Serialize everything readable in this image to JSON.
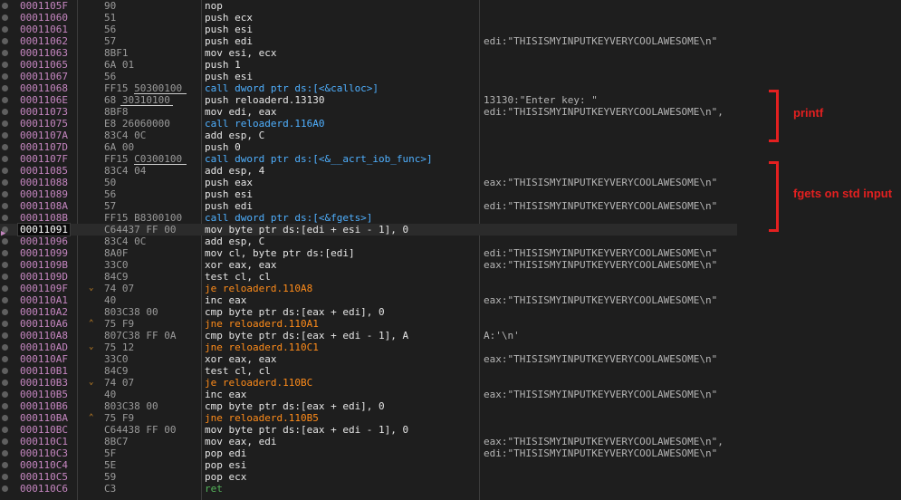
{
  "rows": [
    {
      "addr": "0001105F",
      "bytes": "90",
      "instr": "nop",
      "comment": ""
    },
    {
      "addr": "00011060",
      "bytes": "51",
      "instr": "push ecx",
      "comment": ""
    },
    {
      "addr": "00011061",
      "bytes": "56",
      "instr": "push esi",
      "comment": ""
    },
    {
      "addr": "00011062",
      "bytes": "57",
      "instr": "push edi",
      "comment": "edi:\"THISISMYINPUTKEYVERYCOOLAWESOME\\n\""
    },
    {
      "addr": "00011063",
      "bytes": "8BF1",
      "instr": "mov esi, ecx",
      "comment": ""
    },
    {
      "addr": "00011065",
      "bytes": "6A 01",
      "instr": "push 1",
      "comment": ""
    },
    {
      "addr": "00011067",
      "bytes": "56",
      "instr": "push esi",
      "comment": ""
    },
    {
      "addr": "00011068",
      "bytes": "FF15 50300100",
      "instr": "call dword ptr ds:[<&calloc>]",
      "comment": ""
    },
    {
      "addr": "0001106E",
      "bytes": "68 30310100",
      "instr": "push reloaderd.13130",
      "comment": "13130:\"Enter key: \""
    },
    {
      "addr": "00011073",
      "bytes": "8BF8",
      "instr": "mov edi, eax",
      "comment": "edi:\"THISISMYINPUTKEYVERYCOOLAWESOME\\n\","
    },
    {
      "addr": "00011075",
      "bytes": "E8 26060000",
      "instr": "call reloaderd.116A0",
      "comment": ""
    },
    {
      "addr": "0001107A",
      "bytes": "83C4 0C",
      "instr": "add esp, C",
      "comment": ""
    },
    {
      "addr": "0001107D",
      "bytes": "6A 00",
      "instr": "push 0",
      "comment": ""
    },
    {
      "addr": "0001107F",
      "bytes": "FF15 C0300100",
      "instr": "call dword ptr ds:[<&__acrt_iob_func>]",
      "comment": ""
    },
    {
      "addr": "00011085",
      "bytes": "83C4 04",
      "instr": "add esp, 4",
      "comment": ""
    },
    {
      "addr": "00011088",
      "bytes": "50",
      "instr": "push eax",
      "comment": "eax:\"THISISMYINPUTKEYVERYCOOLAWESOME\\n\""
    },
    {
      "addr": "00011089",
      "bytes": "56",
      "instr": "push esi",
      "comment": ""
    },
    {
      "addr": "0001108A",
      "bytes": "57",
      "instr": "push edi",
      "comment": "edi:\"THISISMYINPUTKEYVERYCOOLAWESOME\\n\""
    },
    {
      "addr": "0001108B",
      "bytes": "FF15 B8300100",
      "instr": "call dword ptr ds:[<&fgets>]",
      "comment": ""
    },
    {
      "addr": "00011091",
      "bytes": "C64437 FF 00",
      "instr": "mov byte ptr ds:[edi + esi - 1], 0",
      "comment": ""
    },
    {
      "addr": "00011096",
      "bytes": "83C4 0C",
      "instr": "add esp, C",
      "comment": ""
    },
    {
      "addr": "00011099",
      "bytes": "8A0F",
      "instr": "mov cl, byte ptr ds:[edi]",
      "comment": "edi:\"THISISMYINPUTKEYVERYCOOLAWESOME\\n\""
    },
    {
      "addr": "0001109B",
      "bytes": "33C0",
      "instr": "xor eax, eax",
      "comment": "eax:\"THISISMYINPUTKEYVERYCOOLAWESOME\\n\""
    },
    {
      "addr": "0001109D",
      "bytes": "84C9",
      "instr": "test cl, cl",
      "comment": ""
    },
    {
      "addr": "0001109F",
      "bytes": "74 07",
      "instr": "je reloaderd.110A8",
      "comment": ""
    },
    {
      "addr": "000110A1",
      "bytes": "40",
      "instr": "inc eax",
      "comment": "eax:\"THISISMYINPUTKEYVERYCOOLAWESOME\\n\""
    },
    {
      "addr": "000110A2",
      "bytes": "803C38 00",
      "instr": "cmp byte ptr ds:[eax + edi], 0",
      "comment": ""
    },
    {
      "addr": "000110A6",
      "bytes": "75 F9",
      "instr": "jne reloaderd.110A1",
      "comment": ""
    },
    {
      "addr": "000110A8",
      "bytes": "807C38 FF 0A",
      "instr": "cmp byte ptr ds:[eax + edi - 1], A",
      "comment": "A:'\\n'"
    },
    {
      "addr": "000110AD",
      "bytes": "75 12",
      "instr": "jne reloaderd.110C1",
      "comment": ""
    },
    {
      "addr": "000110AF",
      "bytes": "33C0",
      "instr": "xor eax, eax",
      "comment": "eax:\"THISISMYINPUTKEYVERYCOOLAWESOME\\n\""
    },
    {
      "addr": "000110B1",
      "bytes": "84C9",
      "instr": "test cl, cl",
      "comment": ""
    },
    {
      "addr": "000110B3",
      "bytes": "74 07",
      "instr": "je reloaderd.110BC",
      "comment": ""
    },
    {
      "addr": "000110B5",
      "bytes": "40",
      "instr": "inc eax",
      "comment": "eax:\"THISISMYINPUTKEYVERYCOOLAWESOME\\n\""
    },
    {
      "addr": "000110B6",
      "bytes": "803C38 00",
      "instr": "cmp byte ptr ds:[eax + edi], 0",
      "comment": ""
    },
    {
      "addr": "000110BA",
      "bytes": "75 F9",
      "instr": "jne reloaderd.110B5",
      "comment": ""
    },
    {
      "addr": "000110BC",
      "bytes": "C64438 FF 00",
      "instr": "mov byte ptr ds:[eax + edi - 1], 0",
      "comment": ""
    },
    {
      "addr": "000110C1",
      "bytes": "8BC7",
      "instr": "mov eax, edi",
      "comment": "eax:\"THISISMYINPUTKEYVERYCOOLAWESOME\\n\","
    },
    {
      "addr": "000110C3",
      "bytes": "5F",
      "instr": "pop edi",
      "comment": "edi:\"THISISMYINPUTKEYVERYCOOLAWESOME\\n\""
    },
    {
      "addr": "000110C4",
      "bytes": "5E",
      "instr": "pop esi",
      "comment": ""
    },
    {
      "addr": "000110C5",
      "bytes": "59",
      "instr": "pop ecx",
      "comment": ""
    },
    {
      "addr": "000110C6",
      "bytes": "C3",
      "instr": "ret",
      "comment": ""
    }
  ],
  "annotations": {
    "printf_label": "printf",
    "fgets_label": "fgets on std input"
  },
  "colors": {
    "address": "#c586c0",
    "call": "#4fb0ff",
    "jump": "#ff8c1a",
    "ret": "#56b65c",
    "annotation": "#e32020"
  }
}
